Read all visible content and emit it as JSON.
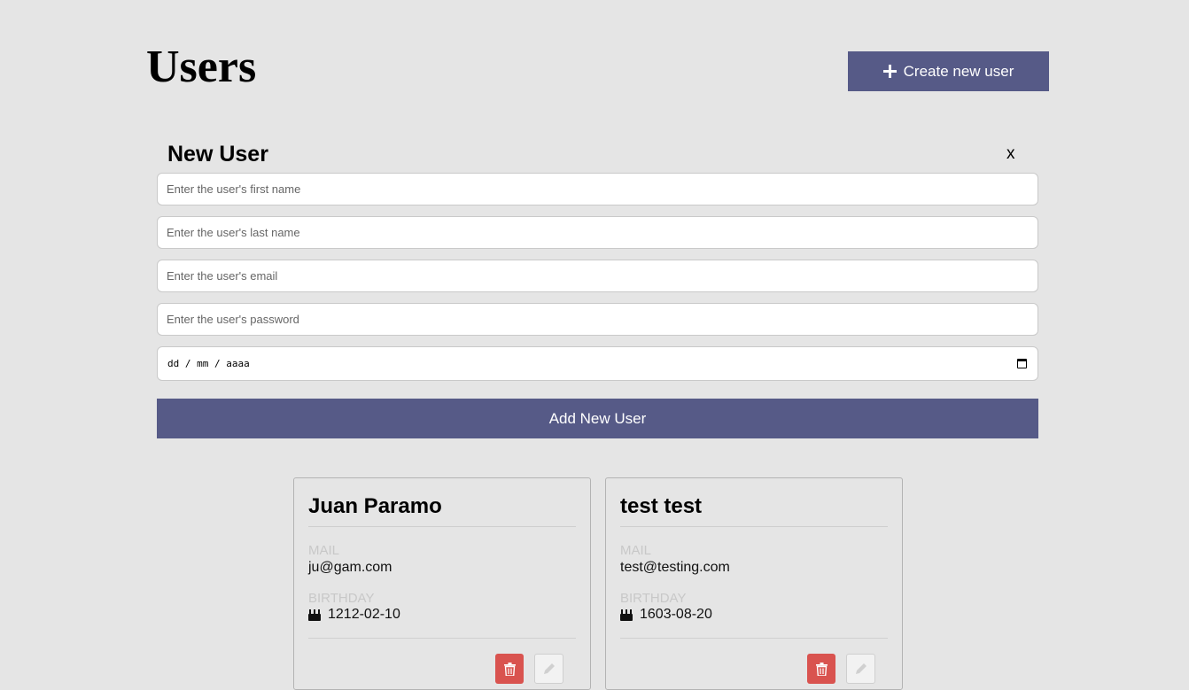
{
  "header": {
    "title": "Users",
    "create_label": "Create new user"
  },
  "form": {
    "title": "New User",
    "close_label": "x",
    "first_name_placeholder": "Enter the user's first name",
    "last_name_placeholder": "Enter the user's last name",
    "email_placeholder": "Enter the user's email",
    "password_placeholder": "Enter the user's password",
    "date_placeholder": "dd / mm / aaaa",
    "submit_label": "Add New User"
  },
  "card_labels": {
    "mail": "MAIL",
    "birthday": "BIRTHDAY"
  },
  "users": [
    {
      "name": "Juan Paramo",
      "email": "ju@gam.com",
      "birthday": "1212-02-10"
    },
    {
      "name": "test test",
      "email": "test@testing.com",
      "birthday": "1603-08-20"
    }
  ],
  "colors": {
    "primary": "#565a87",
    "danger": "#d9534f",
    "background": "#e5e5e5"
  },
  "icons": {
    "create": "plus-icon",
    "date": "calendar-icon",
    "birthday": "cake-icon",
    "delete": "trash-icon",
    "edit": "pencil-icon"
  }
}
